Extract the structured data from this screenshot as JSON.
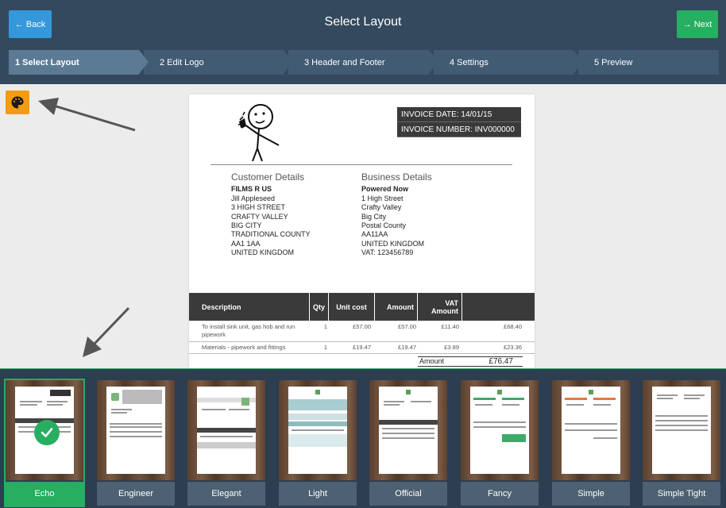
{
  "header": {
    "back_label": "Back",
    "title": "Select Layout",
    "next_label": "Next"
  },
  "steps": [
    {
      "label": "1 Select Layout",
      "active": true
    },
    {
      "label": "2 Edit Logo",
      "active": false
    },
    {
      "label": "3 Header and Footer",
      "active": false
    },
    {
      "label": "4 Settings",
      "active": false
    },
    {
      "label": "5 Preview",
      "active": false
    }
  ],
  "tools": {
    "palette_icon": "palette-icon"
  },
  "invoice": {
    "invoice_date": "INVOICE DATE: 14/01/15",
    "invoice_number": "INVOICE NUMBER: INV000000",
    "customer": {
      "heading": "Customer Details",
      "name": "FILMS R US",
      "lines": [
        "Jill Appleseed",
        "3 HIGH STREET",
        "CRAFTY VALLEY",
        "BIG CITY",
        "TRADITIONAL COUNTY",
        "AA1 1AA",
        "UNITED KINGDOM"
      ]
    },
    "business": {
      "heading": "Business Details",
      "name": "Powered Now",
      "lines": [
        "1 High Street",
        "Crafty Valley",
        "Big City",
        "Postal County",
        "AA11AA",
        "UNITED KINGDOM",
        "VAT: 123456789"
      ]
    },
    "table": {
      "headers": {
        "description": "Description",
        "qty": "Qty",
        "unit_cost": "Unit cost",
        "amount": "Amount",
        "vat_amount_1": "VAT",
        "vat_amount_2": "Amount"
      },
      "rows": [
        {
          "description_1": "To install sink unit, gas hob and run",
          "description_2": "pipework",
          "qty": "1",
          "unit_cost": "£57.00",
          "amount": "£57.00",
          "vat": "£11.40",
          "total": "£68.40"
        },
        {
          "description_1": "Materials - pipework and fittings",
          "description_2": "",
          "qty": "1",
          "unit_cost": "£19.47",
          "amount": "£19.47",
          "vat": "£3.89",
          "total": "£23.36"
        }
      ],
      "total_label": "Amount",
      "total_value": "£76.47"
    }
  },
  "layouts": [
    {
      "label": "Echo",
      "selected": true
    },
    {
      "label": "Engineer",
      "selected": false
    },
    {
      "label": "Elegant",
      "selected": false
    },
    {
      "label": "Light",
      "selected": false
    },
    {
      "label": "Official",
      "selected": false
    },
    {
      "label": "Fancy",
      "selected": false
    },
    {
      "label": "Simple",
      "selected": false
    },
    {
      "label": "Simple Tight",
      "selected": false
    }
  ],
  "colors": {
    "header_bg": "#34495e",
    "back_button": "#3498db",
    "next_button": "#27ae60",
    "palette_button": "#f39c12",
    "selected_layout": "#27ae60",
    "layout_label_bg": "#4e6173"
  }
}
